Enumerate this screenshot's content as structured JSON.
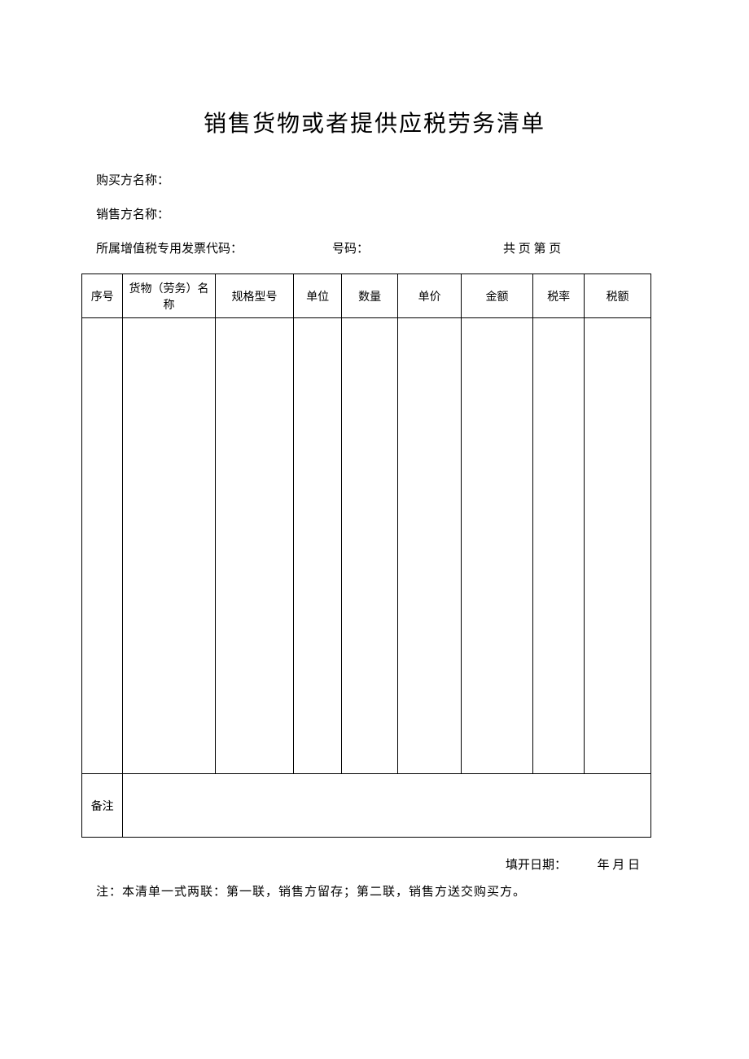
{
  "title": "销售货物或者提供应税劳务清单",
  "fields": {
    "buyer_label": "购买方名称：",
    "seller_label": "销售方名称：",
    "invoice_code_label": "所属增值税专用发票代码：",
    "number_label": "号码：",
    "page_label": "共 页 第 页"
  },
  "table": {
    "headers": {
      "seq": "序号",
      "name": "货物（劳务）名称",
      "spec": "规格型号",
      "unit": "单位",
      "qty": "数量",
      "price": "单价",
      "amount": "金额",
      "rate": "税率",
      "tax": "税额"
    },
    "remark_label": "备注"
  },
  "footer": {
    "fill_date_label": "填开日期：",
    "date_suffix": "年 月 日",
    "note": "注：本清单一式两联：第一联，销售方留存；第二联，销售方送交购买方。"
  }
}
